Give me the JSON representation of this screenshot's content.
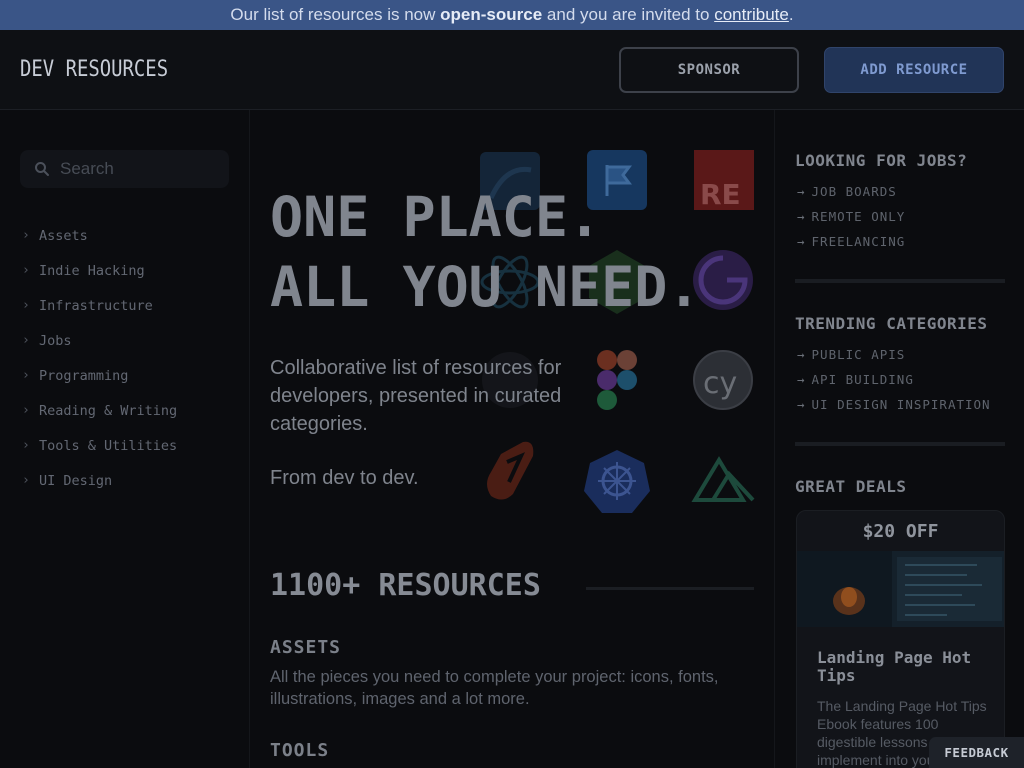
{
  "banner": {
    "text_before": "Our list of resources is now",
    "highlight": "open-source",
    "text_middle": "and you are invited to",
    "link": "contribute",
    "text_after": "."
  },
  "header": {
    "logo": "DEV RESOURCES",
    "sponsor_label": "SPONSOR",
    "add_label": "ADD RESOURCE"
  },
  "sidebar": {
    "search_placeholder": "Search",
    "items": [
      {
        "label": "Assets"
      },
      {
        "label": "Indie Hacking"
      },
      {
        "label": "Infrastructure"
      },
      {
        "label": "Jobs"
      },
      {
        "label": "Programming"
      },
      {
        "label": "Reading & Writing"
      },
      {
        "label": "Tools & Utilities"
      },
      {
        "label": "UI Design"
      }
    ]
  },
  "main": {
    "hero_line1": "ONE PLACE.",
    "hero_line2": "ALL YOU NEED.",
    "lead": "Collaborative list of resources for developers, presented in curated categories.",
    "tagline": "From dev to dev.",
    "resources_title": "1100+ RESOURCES",
    "categories": [
      {
        "title": "ASSETS",
        "description": "All the pieces you need to complete your project: icons, fonts, illustrations, images and a lot more."
      },
      {
        "title": "TOOLS"
      }
    ],
    "logo_icons": [
      "mysql-icon",
      "flag-icon",
      "re-icon",
      "react-icon",
      "node-icon",
      "gatsby-icon",
      "github-icon",
      "figma-icon",
      "cypress-icon",
      "svelte-icon",
      "kubernetes-icon",
      "nuxt-icon"
    ],
    "re_badge": "RE",
    "cy_badge": "cy"
  },
  "right": {
    "jobs_title": "LOOKING FOR JOBS?",
    "jobs": [
      {
        "label": "JOB BOARDS"
      },
      {
        "label": "REMOTE ONLY"
      },
      {
        "label": "FREELANCING"
      }
    ],
    "trending_title": "TRENDING CATEGORIES",
    "trending": [
      {
        "label": "PUBLIC APIS"
      },
      {
        "label": "API BUILDING"
      },
      {
        "label": "UI DESIGN INSPIRATION"
      }
    ],
    "deals_title": "GREAT DEALS",
    "deal": {
      "badge": "$20 OFF",
      "title": "Landing Page Hot Tips",
      "description": "The Landing Page Hot Tips Ebook features 100 digestible lessons to implement into your"
    }
  },
  "feedback_label": "FEEDBACK",
  "colors": {
    "banner": "#3a5587",
    "background": "#0b0c0f",
    "add_button": "#213457"
  }
}
